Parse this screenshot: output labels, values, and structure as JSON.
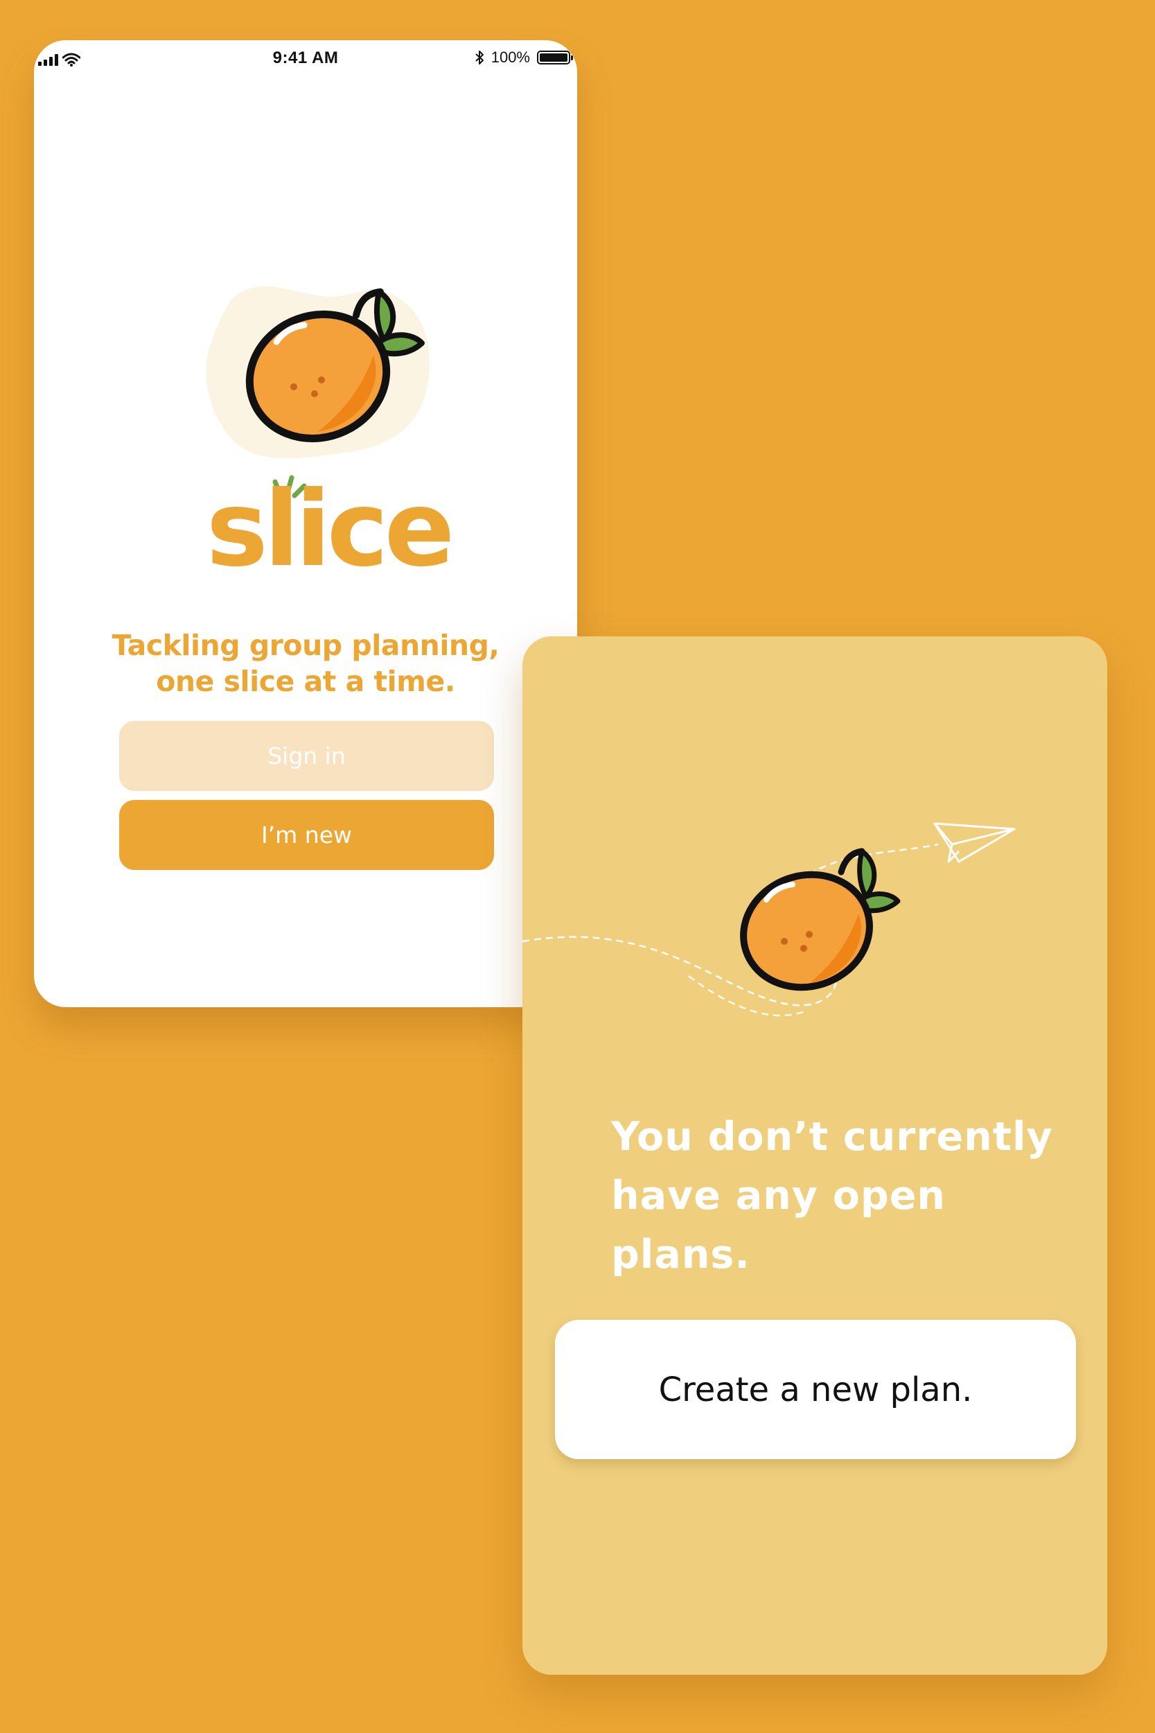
{
  "colors": {
    "background": "#eca634",
    "accent": "#eca634",
    "accent_light": "#f8e2c0",
    "card_yellow": "#efcf7e",
    "orange_fruit": "#f29a2e",
    "leaf_green": "#6ea745"
  },
  "welcome_screen": {
    "status_bar": {
      "time": "9:41 AM",
      "battery": "100%",
      "icons": [
        "signal-icon",
        "wifi-icon",
        "bluetooth-icon",
        "battery-icon"
      ]
    },
    "logo": {
      "wordmark": "slice",
      "icon": "orange-icon"
    },
    "tagline_line1": "Tackling group planning,",
    "tagline_line2": "one slice at a time.",
    "sign_in_label": "Sign in",
    "im_new_label": "I’m new"
  },
  "plans_screen": {
    "illustration_icons": [
      "orange-icon",
      "paper-plane-icon"
    ],
    "empty_line1": "You don’t currently",
    "empty_line2": "have any open plans.",
    "create_label": "Create a new plan."
  }
}
